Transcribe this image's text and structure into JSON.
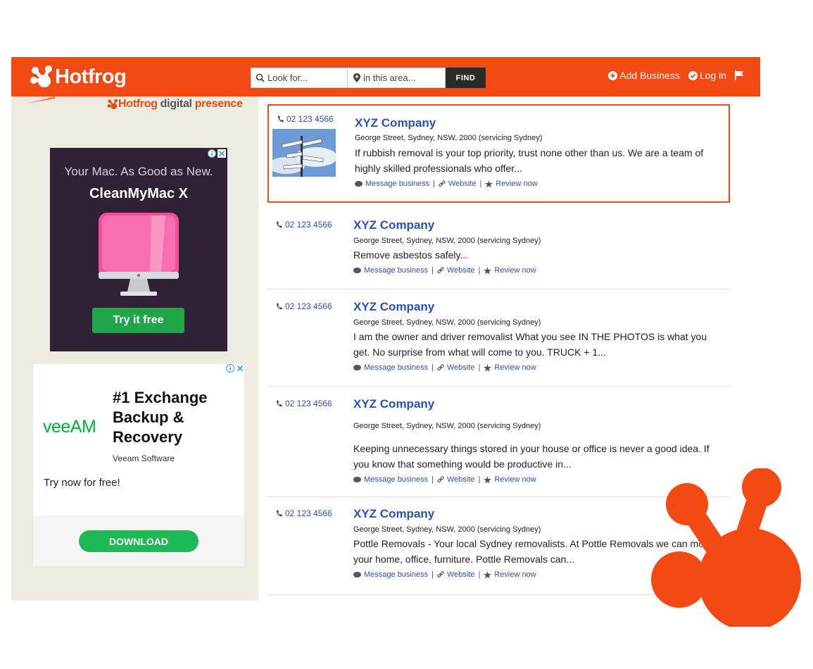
{
  "header": {
    "logo_text": "Hotfrog",
    "search_placeholder": "Look for...",
    "area_placeholder": "in this area...",
    "find_label": "FIND",
    "add_business": "Add Business",
    "log_in": "Log in"
  },
  "sidebar": {
    "digital_presence": [
      "Hotfrog",
      "digital",
      "presence"
    ],
    "ad1": {
      "line1": "Your Mac. As Good as New.",
      "line2": "CleanMyMac X",
      "cta": "Try it free"
    },
    "ad2": {
      "brand": "veeAM",
      "headline": "#1 Exchange Backup & Recovery",
      "vendor": "Veeam Software",
      "tagline": "Try now for free!",
      "cta": "DOWNLOAD"
    }
  },
  "listings": [
    {
      "phone": "02 123 4566",
      "name": "XYZ Company",
      "address": "George Street, Sydney, NSW, 2000 (servicing Sydney)",
      "description": "If rubbish removal is your top priority, trust none other than us. We are a team of highly skilled professionals who offer...",
      "featured": true
    },
    {
      "phone": "02 123 4566",
      "name": "XYZ Company",
      "address": "George Street, Sydney, NSW, 2000 (servicing Sydney)",
      "description": "Remove asbestos safely...",
      "featured": false
    },
    {
      "phone": "02 123 4566",
      "name": "XYZ Company",
      "address": "George Street, Sydney, NSW, 2000 (servicing Sydney)",
      "description": "I am the owner and driver removalist What you see IN THE PHOTOS is what you get. No surprise from what will come to you. TRUCK + 1...",
      "featured": false
    },
    {
      "phone": "02 123 4566",
      "name": "XYZ Company",
      "address": "George Street, Sydney, NSW, 2000 (servicing Sydney)",
      "description": "Keeping unnecessary things stored in your house or office is never a good idea. If you know that something would be productive in...",
      "featured": false
    },
    {
      "phone": "02 123 4566",
      "name": "XYZ Company",
      "address": "George Street, Sydney, NSW, 2000 (servicing Sydney)",
      "description": "Pottle Removals - Your local Sydney removalists. At Pottle Removals we can move your home, office, furniture. Pottle Removals can...",
      "featured": false
    }
  ],
  "listing_links": {
    "message": "Message business",
    "website": "Website",
    "review": "Review now"
  },
  "colors": {
    "brand": "#f24a12",
    "link": "#2a52be",
    "page_bg": "#ecebe0"
  },
  "icons": [
    "frog-logo-icon",
    "search-icon",
    "location-pin-icon",
    "plus-circle-icon",
    "check-circle-icon",
    "flag-icon",
    "phone-icon",
    "chat-icon",
    "link-icon",
    "star-icon",
    "ad-info-icon",
    "ad-close-icon"
  ]
}
